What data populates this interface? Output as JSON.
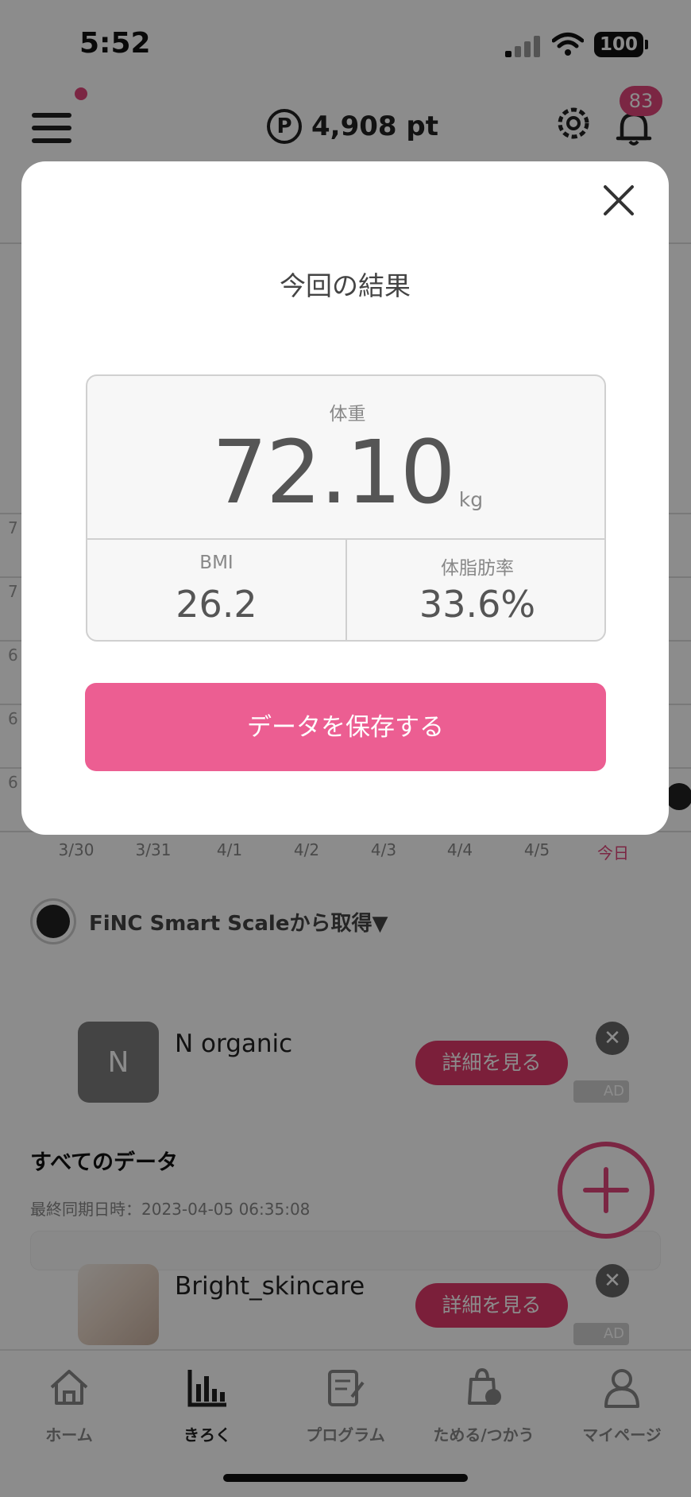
{
  "status": {
    "time": "5:52",
    "battery": "100"
  },
  "header": {
    "points": "4,908 pt",
    "points_symbol": "P",
    "notification_count": "83"
  },
  "chart": {
    "y_labels": [
      "7",
      "7",
      "6",
      "6",
      "6"
    ],
    "dates": [
      "3/30",
      "3/31",
      "4/1",
      "4/2",
      "4/3",
      "4/4",
      "4/5",
      "今日"
    ]
  },
  "source": {
    "label": "FiNC Smart Scaleから取得▼"
  },
  "ads": [
    {
      "title": "N organic",
      "logo_text": "N",
      "button": "詳細を見る",
      "close": "✕",
      "tag": "AD"
    },
    {
      "title": "Bright_skincare",
      "button": "詳細を見る",
      "close": "✕",
      "tag": "AD"
    }
  ],
  "all_data": {
    "title": "すべてのデータ",
    "last_sync": "最終同期日時：2023-04-05 06:35:08"
  },
  "tabs": [
    {
      "label": "ホーム",
      "icon": "home-icon"
    },
    {
      "label": "きろく",
      "icon": "chart-icon"
    },
    {
      "label": "プログラム",
      "icon": "program-icon"
    },
    {
      "label": "ためる/つかう",
      "icon": "points-bag-icon"
    },
    {
      "label": "マイページ",
      "icon": "person-icon"
    }
  ],
  "modal": {
    "title": "今回の結果",
    "weight_label": "体重",
    "weight_value": "72.10",
    "weight_unit": "kg",
    "bmi_label": "BMI",
    "bmi_value": "26.2",
    "fat_label": "体脂肪率",
    "fat_value": "33.6%",
    "save_button": "データを保存する"
  },
  "colors": {
    "accent": "#ec5e92",
    "badge": "#e0457a",
    "ad_button": "#e03a6a"
  }
}
